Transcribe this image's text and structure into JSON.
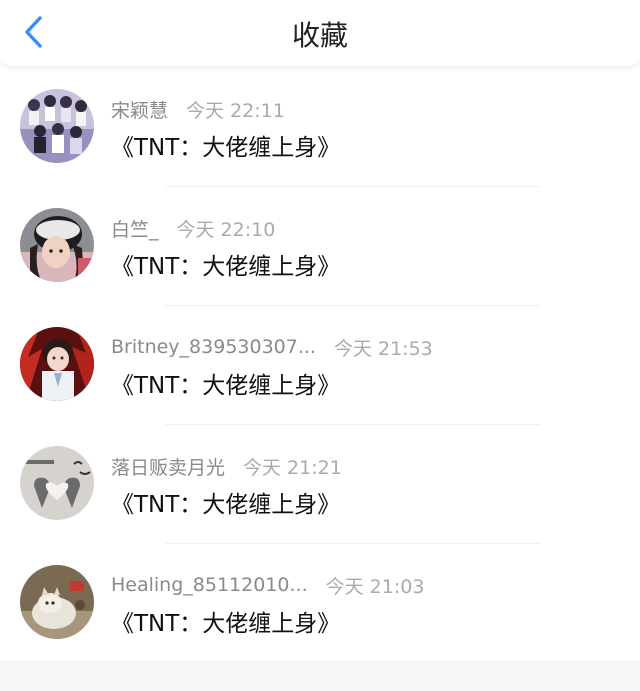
{
  "header": {
    "title": "收藏",
    "back_icon": "chevron-left-icon",
    "accent_color": "#2f8ff5"
  },
  "items": [
    {
      "username": "宋颖慧",
      "time": "今天 22:11",
      "book": "《TNT：大佬缠上身》"
    },
    {
      "username": "白竺_",
      "time": "今天 22:10",
      "book": "《TNT：大佬缠上身》"
    },
    {
      "username": "Britney_839530307...",
      "time": "今天 21:53",
      "book": "《TNT：大佬缠上身》"
    },
    {
      "username": "落日贩卖月光",
      "time": "今天 21:21",
      "book": "《TNT：大佬缠上身》"
    },
    {
      "username": "Healing_85112010...",
      "time": "今天 21:03",
      "book": "《TNT：大佬缠上身》"
    }
  ]
}
